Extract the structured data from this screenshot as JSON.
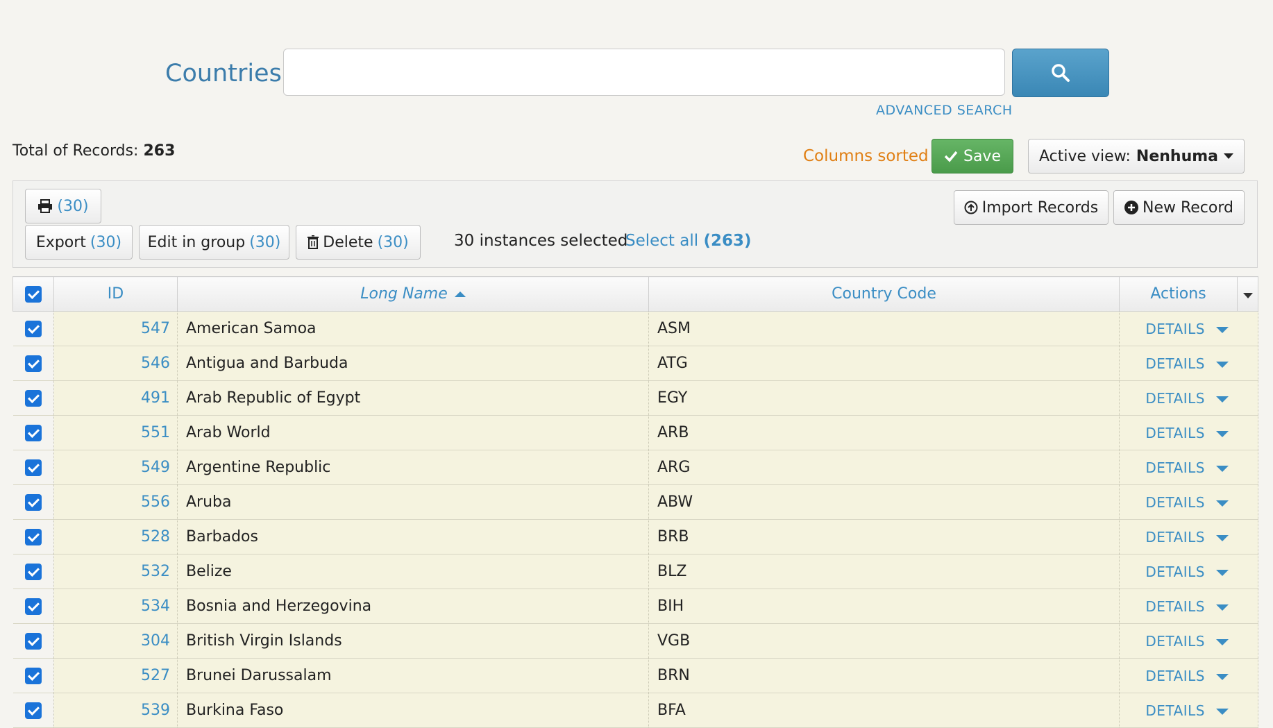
{
  "header": {
    "title": "Countries",
    "search_value": "",
    "advanced_search": "ADVANCED SEARCH"
  },
  "summary": {
    "total_label": "Total of Records:",
    "total_value": "263",
    "columns_sorted": "Columns sorted",
    "save_label": "Save",
    "active_view_label": "Active view:",
    "active_view_value": "Nenhuma"
  },
  "toolbar": {
    "print_count": "(30)",
    "export_label": "Export",
    "export_count": "(30)",
    "edit_group_label": "Edit in group",
    "edit_group_count": "(30)",
    "delete_label": "Delete",
    "delete_count": "(30)",
    "selected_text": "30 instances selected",
    "select_all_label": "Select all",
    "select_all_count": "(263)",
    "import_label": "Import Records",
    "new_record_label": "New Record"
  },
  "table": {
    "columns": [
      "ID",
      "Long Name",
      "Country Code",
      "Actions"
    ],
    "action_label": "DETAILS",
    "rows": [
      {
        "id": "547",
        "name": "American Samoa",
        "code": "ASM"
      },
      {
        "id": "546",
        "name": "Antigua and Barbuda",
        "code": "ATG"
      },
      {
        "id": "491",
        "name": "Arab Republic of Egypt",
        "code": "EGY"
      },
      {
        "id": "551",
        "name": "Arab World",
        "code": "ARB"
      },
      {
        "id": "549",
        "name": "Argentine Republic",
        "code": "ARG"
      },
      {
        "id": "556",
        "name": "Aruba",
        "code": "ABW"
      },
      {
        "id": "528",
        "name": "Barbados",
        "code": "BRB"
      },
      {
        "id": "532",
        "name": "Belize",
        "code": "BLZ"
      },
      {
        "id": "534",
        "name": "Bosnia and Herzegovina",
        "code": "BIH"
      },
      {
        "id": "304",
        "name": "British Virgin Islands",
        "code": "VGB"
      },
      {
        "id": "527",
        "name": "Brunei Darussalam",
        "code": "BRN"
      },
      {
        "id": "539",
        "name": "Burkina Faso",
        "code": "BFA"
      }
    ]
  },
  "colors": {
    "accent": "#3a8dc4",
    "save_green": "#4a9b4a",
    "sorted_orange": "#e07f14",
    "row_bg": "#f5f3df"
  }
}
